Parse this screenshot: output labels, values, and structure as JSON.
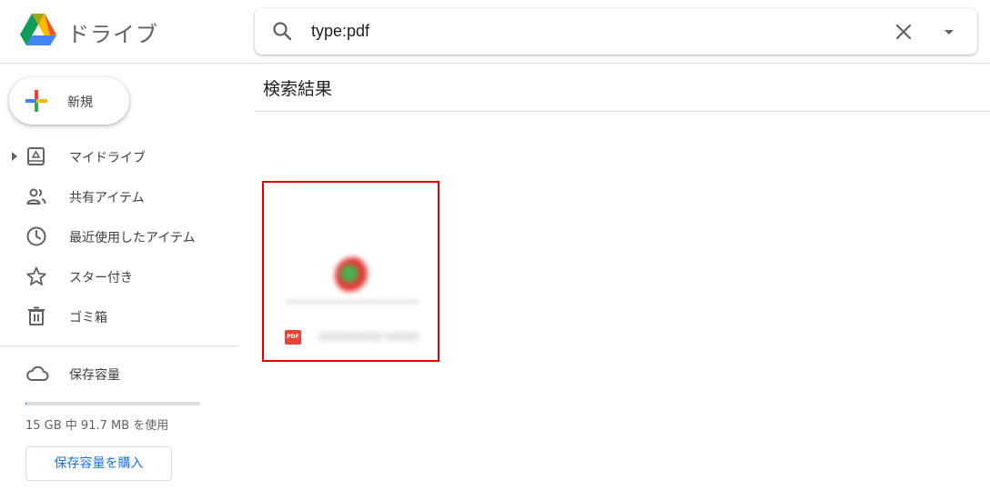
{
  "app": {
    "title": "ドライブ",
    "logo_icon": "google-drive-logo-icon"
  },
  "search": {
    "value": "type:pdf",
    "search_icon": "search-icon",
    "clear_icon": "close-icon",
    "options_icon": "dropdown-arrow-icon"
  },
  "sidebar": {
    "new_label": "新規",
    "items": [
      {
        "label": "マイドライブ",
        "icon": "my-drive-icon",
        "has_arrow": true
      },
      {
        "label": "共有アイテム",
        "icon": "shared-people-icon"
      },
      {
        "label": "最近使用したアイテム",
        "icon": "clock-icon"
      },
      {
        "label": "スター付き",
        "icon": "star-icon"
      },
      {
        "label": "ゴミ箱",
        "icon": "trash-icon"
      }
    ],
    "storage": {
      "label": "保存容量",
      "icon": "cloud-icon",
      "usage_text": "15 GB 中 91.7 MB を使用",
      "used_fraction": 0.006,
      "buy_label": "保存容量を購入"
    }
  },
  "main": {
    "heading": "検索結果",
    "files": [
      {
        "type_badge": "PDF",
        "name": "•••••••••• •••••",
        "highlight_color": "#e00000"
      }
    ]
  },
  "colors": {
    "accent": "#1a73e8",
    "pdf_red": "#ea4335",
    "highlight": "#e00000"
  }
}
